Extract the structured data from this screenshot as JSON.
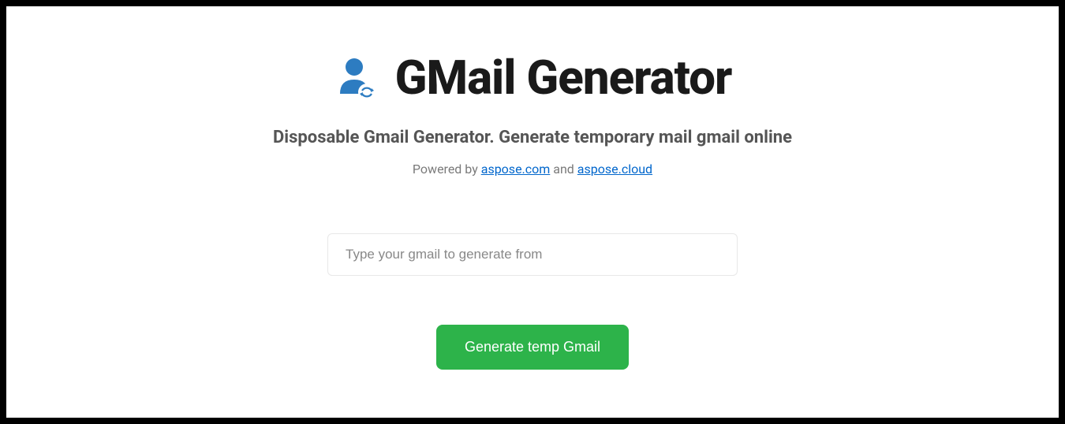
{
  "header": {
    "title": "GMail Generator",
    "subtitle": "Disposable Gmail Generator. Generate temporary mail gmail online"
  },
  "powered": {
    "prefix": "Powered by ",
    "link1_text": "aspose.com",
    "separator": " and ",
    "link2_text": "aspose.cloud"
  },
  "input": {
    "placeholder": "Type your gmail to generate from",
    "value": ""
  },
  "button": {
    "generate_label": "Generate temp Gmail"
  }
}
